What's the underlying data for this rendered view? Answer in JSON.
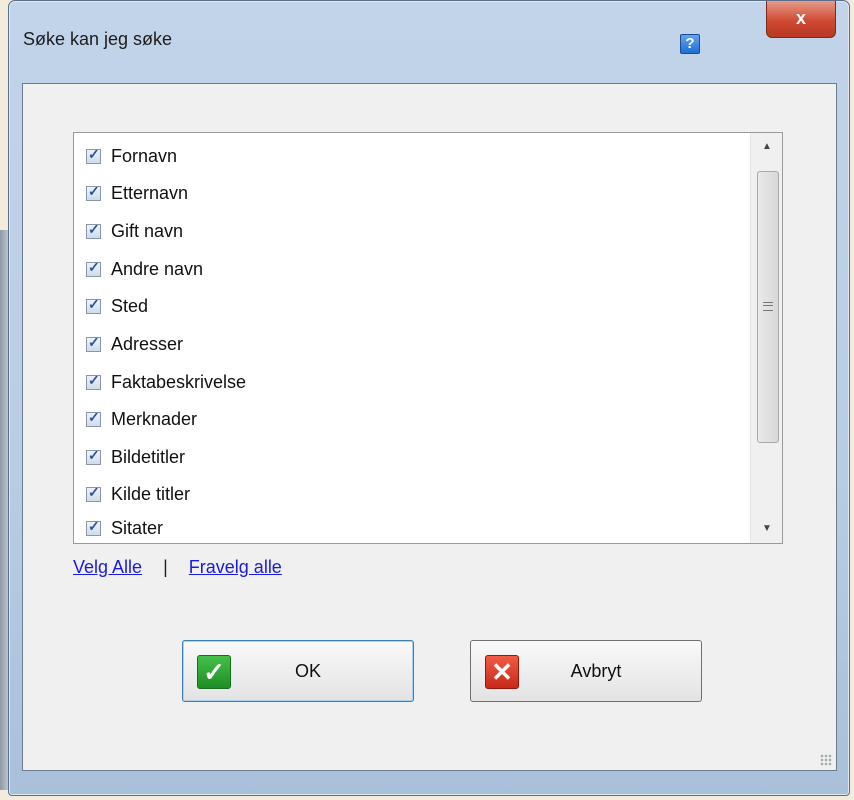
{
  "window": {
    "title": "Søke kan jeg søke",
    "help_glyph": "?",
    "close_glyph": "x"
  },
  "fields": {
    "items": [
      {
        "label": "Fornavn",
        "checked": true
      },
      {
        "label": "Etternavn",
        "checked": true
      },
      {
        "label": "Gift navn",
        "checked": true
      },
      {
        "label": "Andre navn",
        "checked": true
      },
      {
        "label": "Sted",
        "checked": true
      },
      {
        "label": "Adresser",
        "checked": true
      },
      {
        "label": "Faktabeskrivelse",
        "checked": true
      },
      {
        "label": "Merknader",
        "checked": true
      },
      {
        "label": "Bildetitler",
        "checked": true
      },
      {
        "label": "Kilde titler",
        "checked": true
      },
      {
        "label": "Sitater",
        "checked": true
      }
    ]
  },
  "links": {
    "select_all": "Velg Alle",
    "separator": "|",
    "deselect_all": "Fravelg alle"
  },
  "buttons": {
    "ok": "OK",
    "cancel": "Avbryt"
  },
  "colors": {
    "accent_link": "#1a1ae6",
    "ok_icon": "#2ea832",
    "cancel_icon": "#d93a26"
  }
}
